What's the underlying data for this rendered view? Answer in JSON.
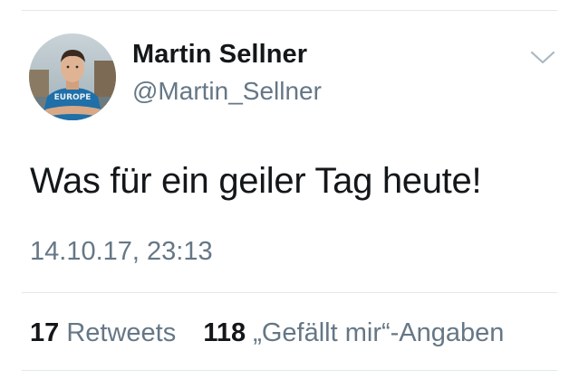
{
  "tweet": {
    "author": {
      "display_name": "Martin Sellner",
      "handle": "@Martin_Sellner",
      "avatar_shirt_text": "EUROPE"
    },
    "menu_icon": "chevron-down-icon",
    "text": "Was für ein geiler Tag heute!",
    "timestamp": "14.10.17, 23:13",
    "stats": {
      "retweets_count": "17",
      "retweets_label": "Retweets",
      "likes_count": "118",
      "likes_label": "„Gefällt mir“-Angaben"
    }
  },
  "colors": {
    "text_primary": "#14171a",
    "text_secondary": "#657786",
    "divider": "#e1e8ed",
    "chevron": "#aab8c2"
  }
}
